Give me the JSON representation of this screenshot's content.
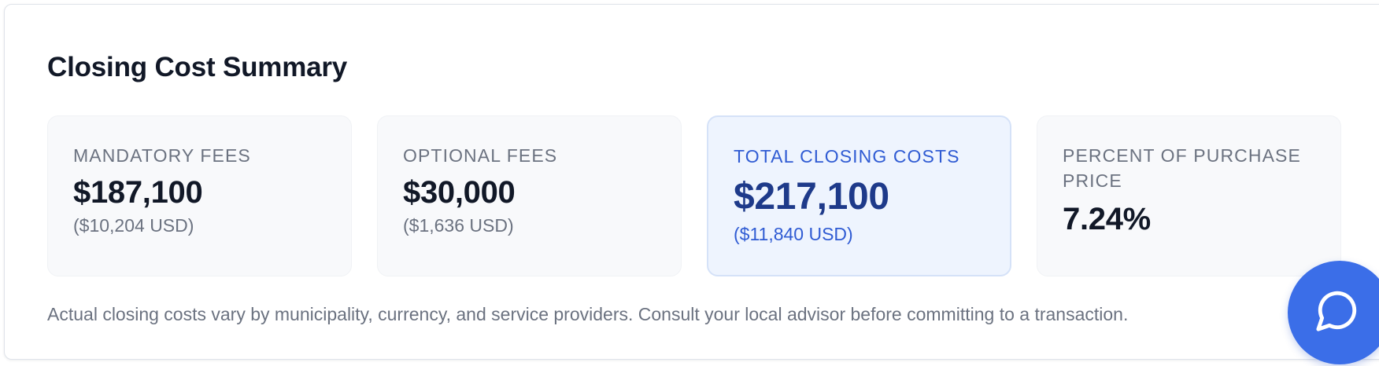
{
  "summary": {
    "title": "Closing Cost Summary",
    "stats": [
      {
        "label": "MANDATORY FEES",
        "value": "$187,100",
        "sub": "($10,204 USD)"
      },
      {
        "label": "OPTIONAL FEES",
        "value": "$30,000",
        "sub": "($1,636 USD)"
      },
      {
        "label": "TOTAL CLOSING COSTS",
        "value": "$217,100",
        "sub": "($11,840 USD)"
      },
      {
        "label": "PERCENT OF PURCHASE PRICE",
        "value": "7.24%"
      }
    ],
    "disclaimer": "Actual closing costs vary by municipality, currency, and service providers. Consult your local advisor before committing to a transaction."
  },
  "chat": {
    "icon": "chat-bubble-icon"
  },
  "colors": {
    "accent": "#3b6ee8",
    "highlight_text": "#2f5bd3",
    "highlight_value": "#1e3a8a",
    "highlight_bg": "#eef4fe"
  }
}
